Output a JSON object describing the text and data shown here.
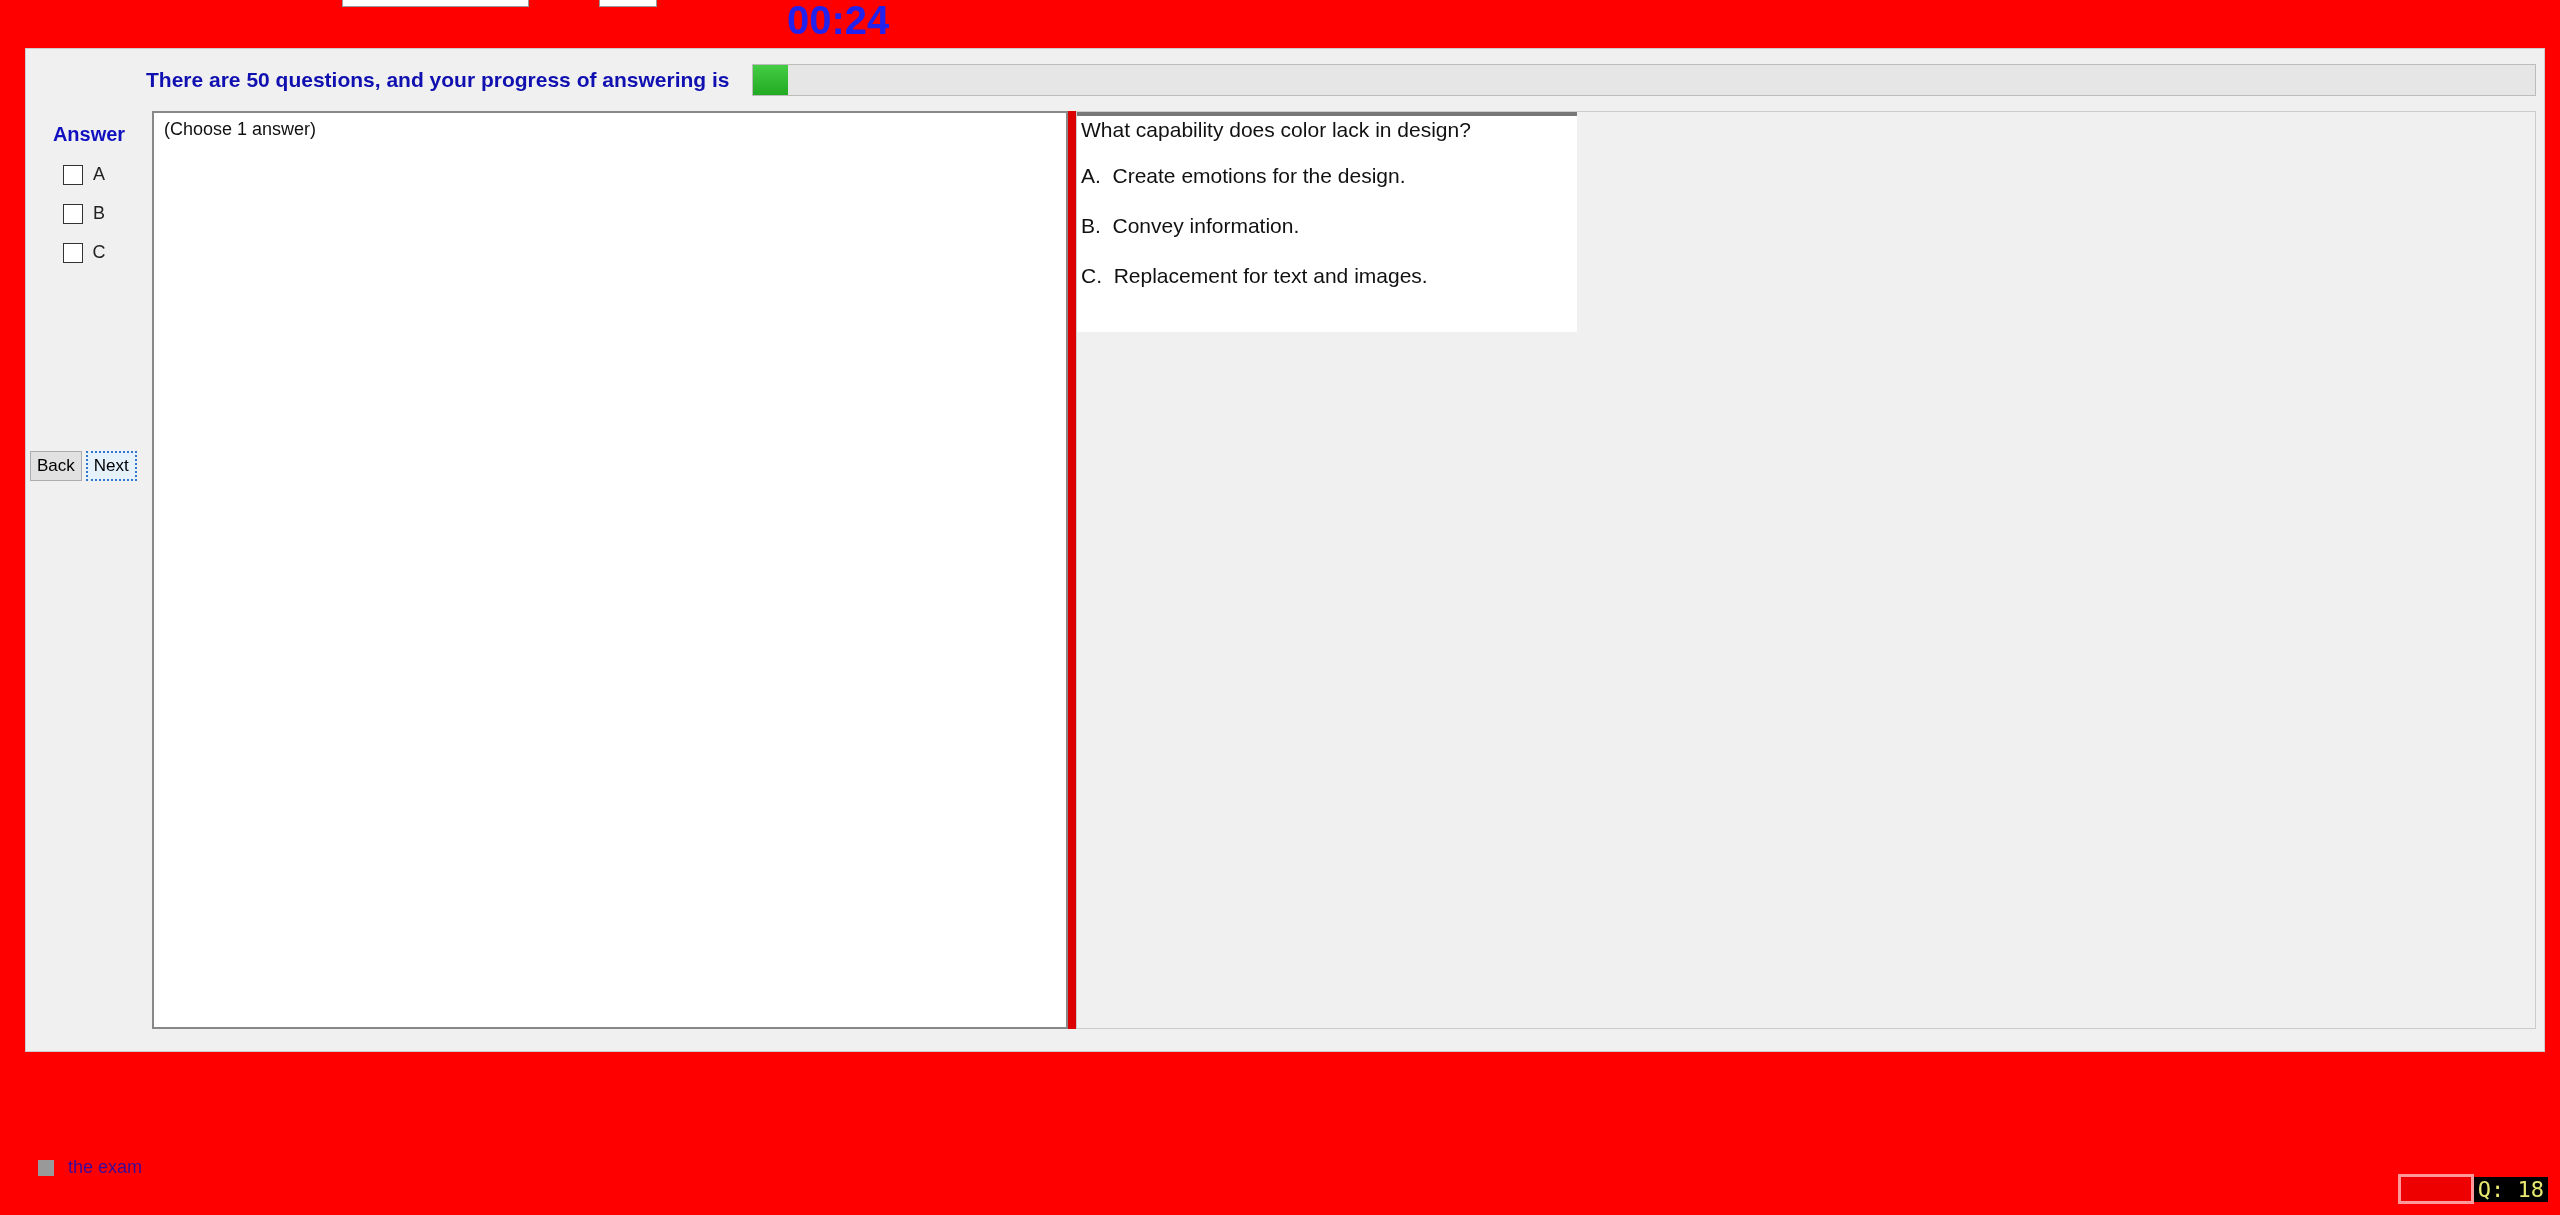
{
  "timer": "00:24",
  "progress": {
    "label": "There are 50 questions, and your progress of answering is",
    "level": 0.02
  },
  "answer": {
    "title": "Answer",
    "options": [
      {
        "label": "A",
        "checked": false
      },
      {
        "label": "B",
        "checked": false
      },
      {
        "label": "C",
        "checked": false
      }
    ]
  },
  "buttons": [
    {
      "label": "Back",
      "focused": false
    },
    {
      "label": "Next",
      "focused": true
    }
  ],
  "answer_box": {
    "text": "(Choose 1 answer)"
  },
  "question": {
    "text": "What capability does color lack in design?",
    "choices": [
      {
        "letter": "A.",
        "text": "Create emotions for the design."
      },
      {
        "letter": "B.",
        "text": "Convey information."
      },
      {
        "letter": "C.",
        "text": "Replacement for text and images."
      }
    ]
  },
  "finish": {
    "label": "the exam",
    "checked": false
  },
  "counter": {
    "text": "Q: 18"
  }
}
